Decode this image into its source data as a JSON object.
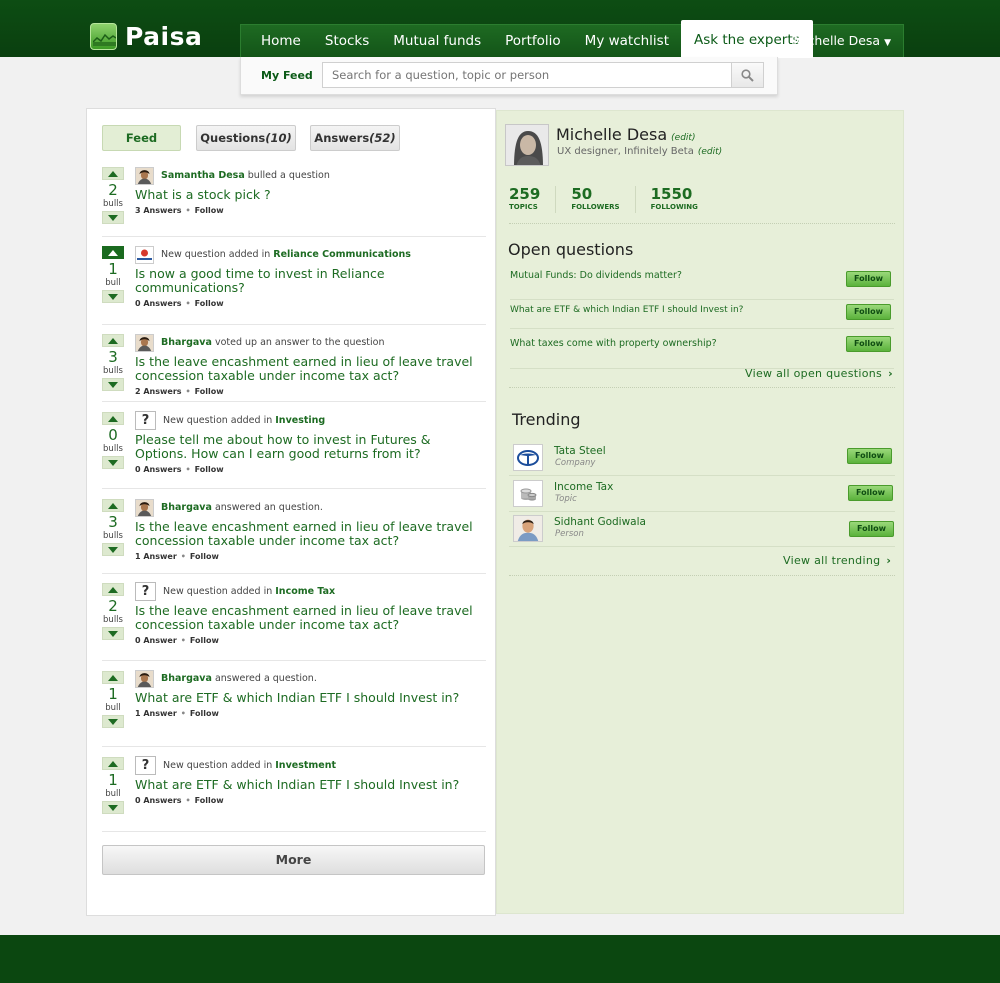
{
  "brand": {
    "name": "Paisa"
  },
  "nav": {
    "items": [
      "Home",
      "Stocks",
      "Mutual funds",
      "Portfolio",
      "My watchlist",
      "Ask the experts"
    ],
    "active_index": 5,
    "user": "Michelle Desa"
  },
  "subnav": {
    "my_feed": "My Feed",
    "search_placeholder": "Search for a question, topic or person"
  },
  "tabs": {
    "feed": "Feed",
    "questions": "Questions",
    "questions_count": "(10)",
    "answers": "Answers",
    "answers_count": "(52)"
  },
  "feed": [
    {
      "votes": "2",
      "unit": "bulls",
      "up_active": false,
      "meta_kind": "avatar",
      "actor": "Samantha Desa",
      "action": " bulled a question",
      "topic": "",
      "title": "What is a stock pick ?",
      "answers": "3 Answers",
      "follow": "Follow"
    },
    {
      "votes": "1",
      "unit": "bull",
      "up_active": true,
      "meta_kind": "logo",
      "actor": "",
      "action": "New question added in ",
      "topic": "Reliance Communications",
      "title": "Is now a good time to invest in Reliance communications?",
      "answers": "0 Answers",
      "follow": "Follow"
    },
    {
      "votes": "3",
      "unit": "bulls",
      "up_active": false,
      "meta_kind": "avatar",
      "actor": "Bhargava",
      "action": " voted up an answer to the question",
      "topic": "",
      "title": "Is the leave encashment earned in lieu of leave travel concession taxable under income tax act?",
      "answers": "2 Answers",
      "follow": "Follow"
    },
    {
      "votes": "0",
      "unit": "bulls",
      "up_active": false,
      "meta_kind": "question",
      "actor": "",
      "action": "New question added in ",
      "topic": "Investing",
      "title": "Please tell me about how to invest in Futures & Options. How can I earn good returns from it?",
      "answers": "0 Answers",
      "follow": "Follow"
    },
    {
      "votes": "3",
      "unit": "bulls",
      "up_active": false,
      "meta_kind": "avatar",
      "actor": "Bhargava",
      "action": " answered an question.",
      "topic": "",
      "title": "Is the leave encashment earned in lieu of leave travel concession taxable under income tax act?",
      "answers": "1 Answer",
      "follow": "Follow"
    },
    {
      "votes": "2",
      "unit": "bulls",
      "up_active": false,
      "meta_kind": "question",
      "actor": "",
      "action": "New question added in ",
      "topic": "Income Tax",
      "title": "Is the leave encashment earned in lieu of leave travel concession taxable under income tax act?",
      "answers": "0 Answer",
      "follow": "Follow"
    },
    {
      "votes": "1",
      "unit": "bull",
      "up_active": false,
      "meta_kind": "avatar",
      "actor": "Bhargava",
      "action": " answered a question.",
      "topic": "",
      "title": "What are ETF & which Indian ETF I should Invest in?",
      "answers": "1 Answer",
      "follow": "Follow"
    },
    {
      "votes": "1",
      "unit": "bull",
      "up_active": false,
      "meta_kind": "question",
      "actor": "",
      "action": "New question added in ",
      "topic": "Investment",
      "title": "What are ETF & which Indian ETF I should Invest in?",
      "answers": "0 Answers",
      "follow": "Follow"
    }
  ],
  "more_label": "More",
  "profile": {
    "name": "Michelle Desa",
    "edit": "(edit)",
    "role": "UX designer, Infinitely Beta",
    "stats": [
      {
        "num": "259",
        "label": "TOPICS"
      },
      {
        "num": "50",
        "label": "FOLLOWERS"
      },
      {
        "num": "1550",
        "label": "FOLLOWING"
      }
    ]
  },
  "open_questions": {
    "title": "Open questions",
    "items": [
      "Mutual Funds: Do dividends matter?",
      "What are ETF & which Indian ETF I should Invest in?",
      "What taxes come with property ownership?"
    ],
    "follow": "Follow",
    "view_all": "View all open questions"
  },
  "trending": {
    "title": "Trending",
    "items": [
      {
        "name": "Tata Steel",
        "type": "Company",
        "icon": "tata-logo-icon"
      },
      {
        "name": "Income Tax",
        "type": "Topic",
        "icon": "coins-icon"
      },
      {
        "name": "Sidhant Godiwala",
        "type": "Person",
        "icon": "person-avatar-icon"
      }
    ],
    "follow": "Follow",
    "view_all": "View all trending"
  },
  "colors": {
    "brand_green": "#1d6b22",
    "header_dark": "#0a3f0f",
    "panel_green": "#e7efd9"
  }
}
